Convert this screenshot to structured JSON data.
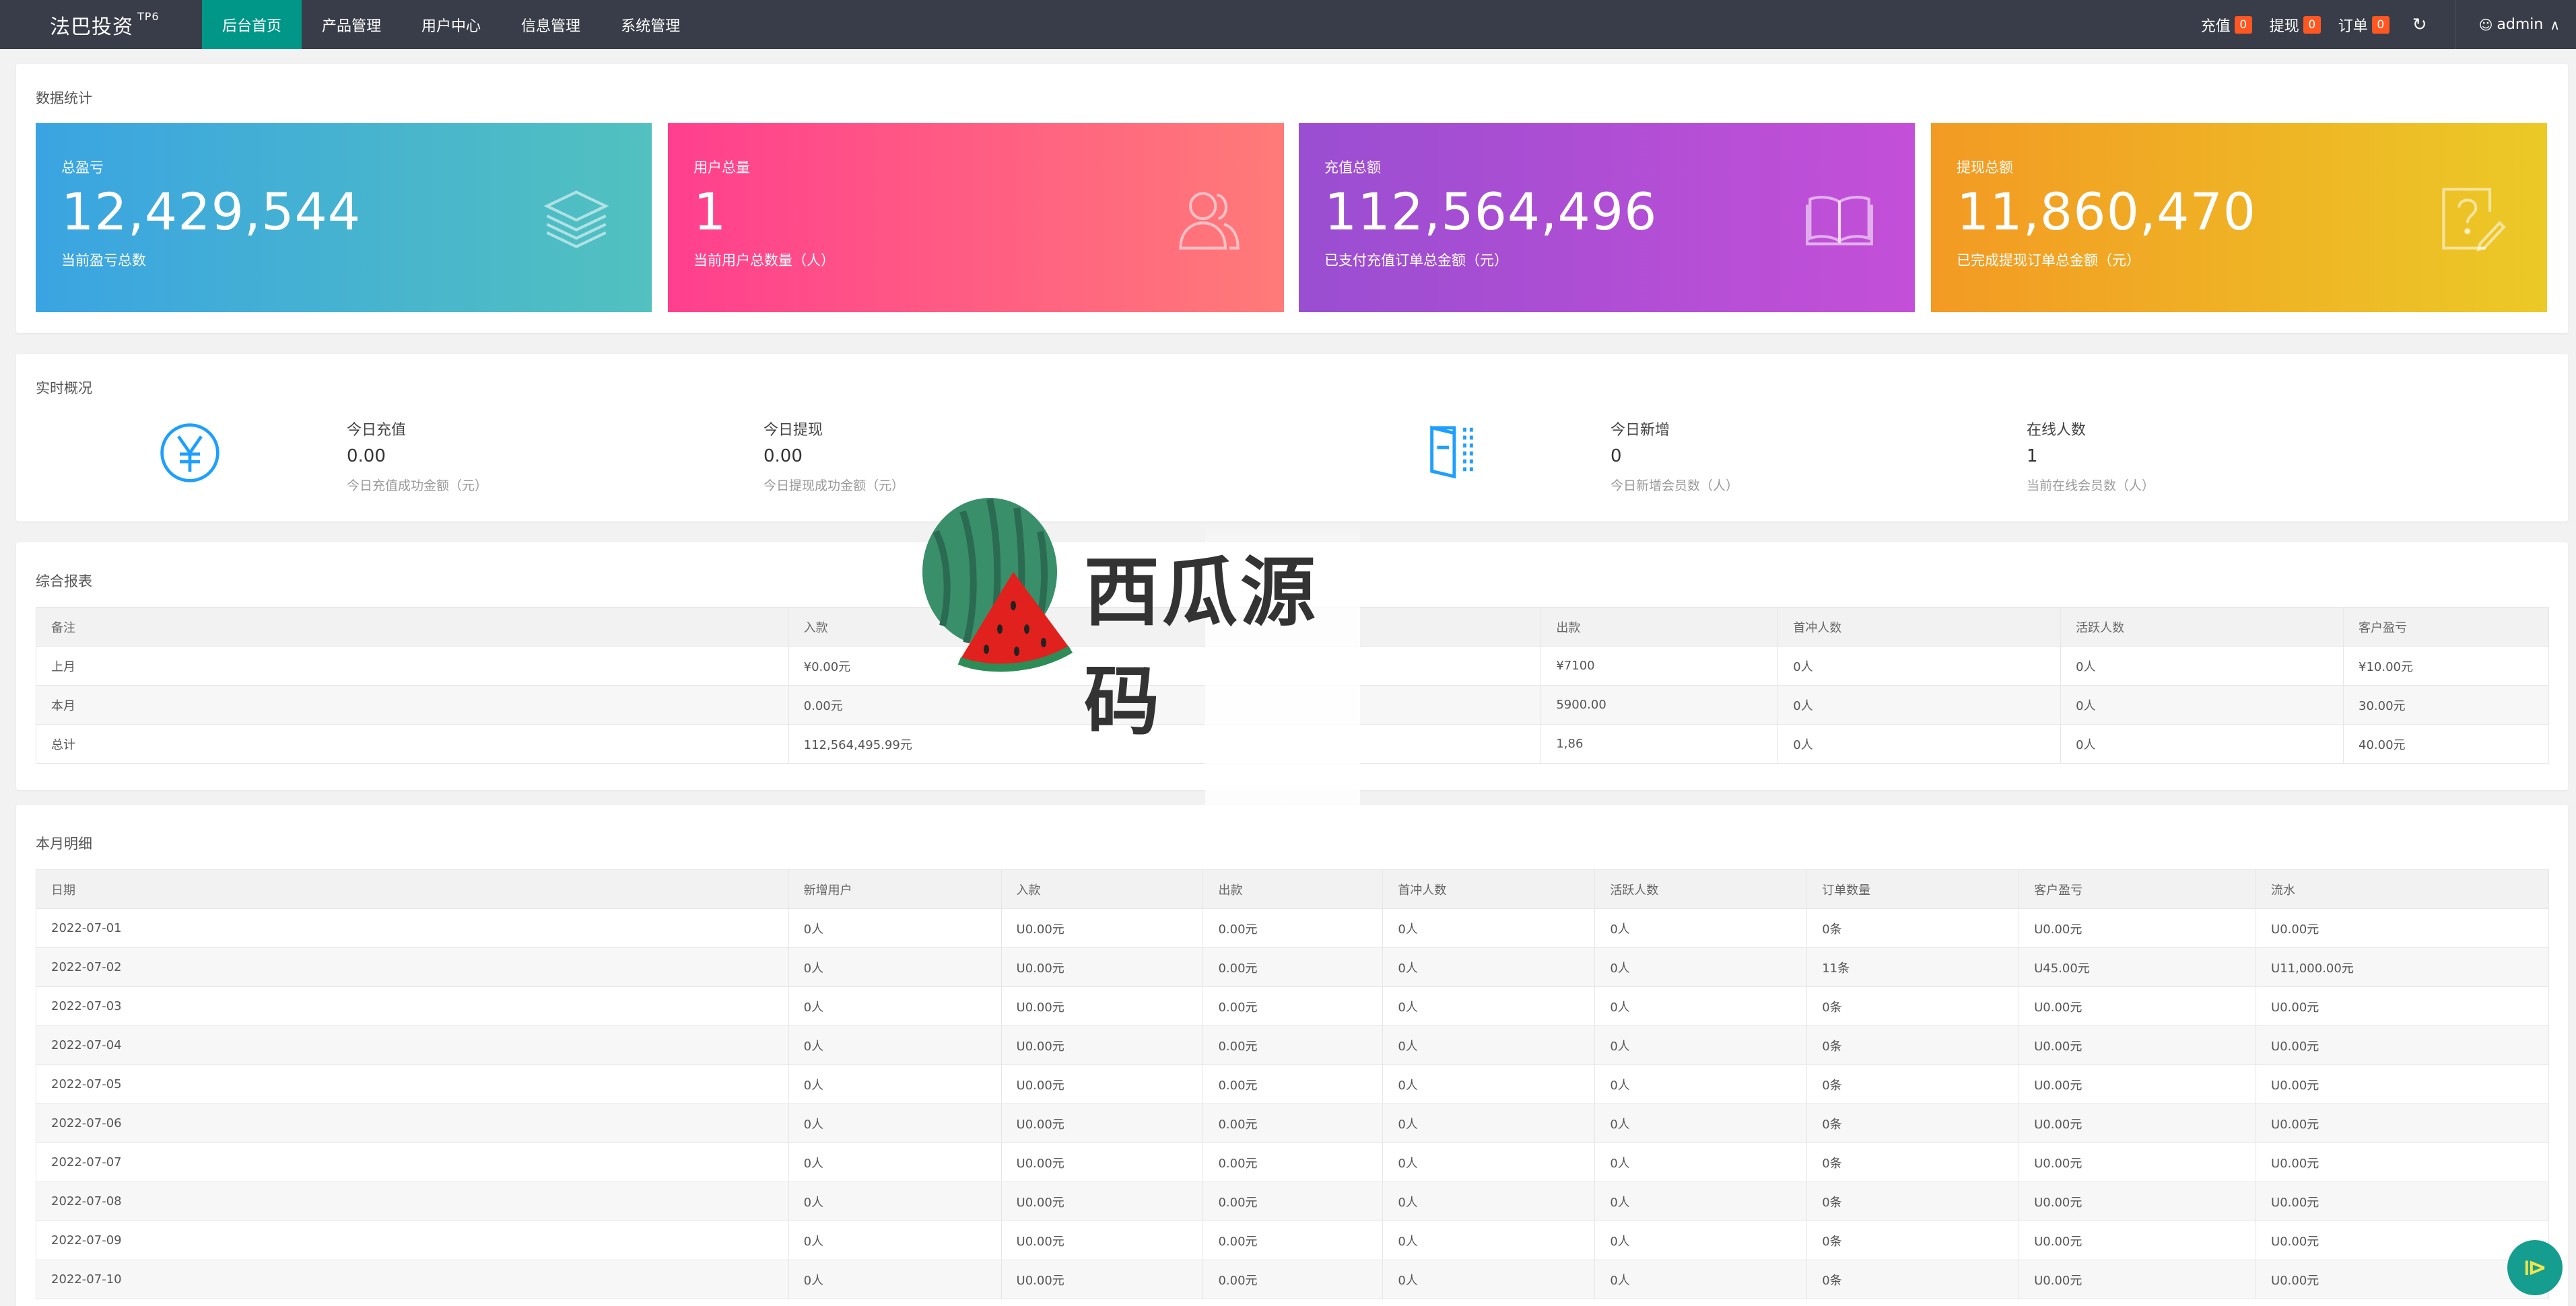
{
  "header": {
    "brand": "法巴投资",
    "brand_sup": "TP6",
    "nav": [
      {
        "label": "后台首页"
      },
      {
        "label": "产品管理"
      },
      {
        "label": "用户中心"
      },
      {
        "label": "信息管理"
      },
      {
        "label": "系统管理"
      }
    ],
    "recharge_label": "充值",
    "recharge_count": "0",
    "withdraw_label": "提现",
    "withdraw_count": "0",
    "order_label": "订单",
    "order_count": "0",
    "user": "admin"
  },
  "stats": {
    "title": "数据统计",
    "cards": [
      {
        "label": "总盈亏",
        "value": "12,429,544",
        "sub": "当前盈亏总数",
        "icon": "layers-icon"
      },
      {
        "label": "用户总量",
        "value": "1",
        "sub": "当前用户总数量（人）",
        "icon": "users-icon"
      },
      {
        "label": "充值总额",
        "value": "112,564,496",
        "sub": "已支付充值订单总金额（元）",
        "icon": "book-icon"
      },
      {
        "label": "提现总额",
        "value": "11,860,470",
        "sub": "已完成提现订单总金额（元）",
        "icon": "edit-question-icon"
      }
    ]
  },
  "realtime": {
    "title": "实时概况",
    "items": [
      {
        "title": "今日充值",
        "value": "0.00",
        "desc": "今日充值成功金额（元）"
      },
      {
        "title": "今日提现",
        "value": "0.00",
        "desc": "今日提现成功金额（元）"
      },
      {
        "title": "今日新增",
        "value": "0",
        "desc": "今日新增会员数（人）"
      },
      {
        "title": "在线人数",
        "value": "1",
        "desc": "当前在线会员数（人）"
      }
    ]
  },
  "report": {
    "title": "综合报表",
    "headers": [
      "备注",
      "入款",
      "出款",
      "首冲人数",
      "活跃人数",
      "客户盈亏"
    ],
    "rows": [
      [
        "上月",
        "¥0.00元",
        "¥7100",
        "0人",
        "0人",
        "¥10.00元"
      ],
      [
        "本月",
        "0.00元",
        "5900.00",
        "0人",
        "0人",
        "30.00元"
      ],
      [
        "总计",
        "112,564,495.99元",
        "1,86",
        "0人",
        "0人",
        "40.00元"
      ]
    ]
  },
  "monthly": {
    "title": "本月明细",
    "headers": [
      "日期",
      "新增用户",
      "入款",
      "出款",
      "首冲人数",
      "活跃人数",
      "订单数量",
      "客户盈亏",
      "流水"
    ],
    "rows": [
      [
        "2022-07-01",
        "0人",
        "U0.00元",
        "0.00元",
        "0人",
        "0人",
        "0条",
        "U0.00元",
        "U0.00元"
      ],
      [
        "2022-07-02",
        "0人",
        "U0.00元",
        "0.00元",
        "0人",
        "0人",
        "11条",
        "U45.00元",
        "U11,000.00元"
      ],
      [
        "2022-07-03",
        "0人",
        "U0.00元",
        "0.00元",
        "0人",
        "0人",
        "0条",
        "U0.00元",
        "U0.00元"
      ],
      [
        "2022-07-04",
        "0人",
        "U0.00元",
        "0.00元",
        "0人",
        "0人",
        "0条",
        "U0.00元",
        "U0.00元"
      ],
      [
        "2022-07-05",
        "0人",
        "U0.00元",
        "0.00元",
        "0人",
        "0人",
        "0条",
        "U0.00元",
        "U0.00元"
      ],
      [
        "2022-07-06",
        "0人",
        "U0.00元",
        "0.00元",
        "0人",
        "0人",
        "0条",
        "U0.00元",
        "U0.00元"
      ],
      [
        "2022-07-07",
        "0人",
        "U0.00元",
        "0.00元",
        "0人",
        "0人",
        "0条",
        "U0.00元",
        "U0.00元"
      ],
      [
        "2022-07-08",
        "0人",
        "U0.00元",
        "0.00元",
        "0人",
        "0人",
        "0条",
        "U0.00元",
        "U0.00元"
      ],
      [
        "2022-07-09",
        "0人",
        "U0.00元",
        "0.00元",
        "0人",
        "0人",
        "0条",
        "U0.00元",
        "U0.00元"
      ],
      [
        "2022-07-10",
        "0人",
        "U0.00元",
        "0.00元",
        "0人",
        "0人",
        "0条",
        "U0.00元",
        "U0.00元"
      ]
    ]
  },
  "watermark": {
    "text": "西瓜源码"
  }
}
